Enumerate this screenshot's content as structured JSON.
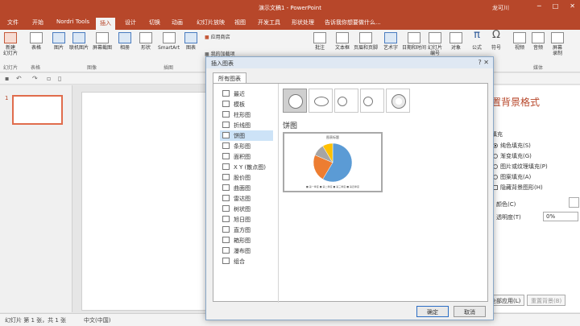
{
  "window": {
    "title": "演示文稿1 - PowerPoint",
    "user": "龙可川",
    "controls": [
      "─",
      "□",
      "✕"
    ]
  },
  "tabs": [
    "文件",
    "开始",
    "Nordri Tools",
    "插入",
    "设计",
    "切换",
    "动画",
    "幻灯片放映",
    "视图",
    "开发工具",
    "形状处理"
  ],
  "active_tab": "插入",
  "tell_me": "告诉我你想要做什么...",
  "ribbon": {
    "new_slide": "新建\n幻灯片",
    "table": "表格",
    "picture": "图片",
    "online_picture": "联机图片",
    "screenshot": "屏幕截图",
    "album": "相册",
    "shapes": "形状",
    "smartart": "SmartArt",
    "chart": "图表",
    "store": "应用商店",
    "my_addins": "我的加载项",
    "comment": "批注",
    "textbox": "文本框",
    "header_footer": "页眉和页脚",
    "wordart": "艺术字",
    "datetime": "日期和时间",
    "slide_number": "幻灯片\n编号",
    "object": "对象",
    "equation": "公式",
    "symbol": "符号",
    "video": "视频",
    "audio": "音频",
    "screen_recording": "屏幕\n录制",
    "groups": {
      "slides": "幻灯片",
      "tables": "表格",
      "images": "图像",
      "illustrations": "插图",
      "media": "媒体"
    }
  },
  "thumbnails": {
    "slide_number": "1"
  },
  "format_pane": {
    "title": "置背景格式",
    "fill_section": "填充",
    "options": [
      "纯色填充(S)",
      "渐变填充(G)",
      "图片或纹理填充(P)",
      "图案填充(A)",
      "隐藏背景图形(H)"
    ],
    "selected_option": "纯色填充(S)",
    "color_label": "颜色(C)",
    "transparency_label": "透明度(T)",
    "transparency_value": "0%",
    "apply_all": "全部应用(L)",
    "reset_background": "重置背景(B)"
  },
  "dialog": {
    "title": "插入图表",
    "close": "?  ✕",
    "tab": "所有图表",
    "categories": [
      "最近",
      "模板",
      "柱形图",
      "折线图",
      "饼图",
      "条形图",
      "面积图",
      "X Y (散点图)",
      "股价图",
      "曲面图",
      "雷达图",
      "树状图",
      "旭日图",
      "直方图",
      "箱形图",
      "瀑布图",
      "组合"
    ],
    "selected_category": "饼图",
    "selected_type": "饼图",
    "preview_title": "图表标题",
    "preview_legend": "■ 第一季度  ■ 第二季度  ■ 第三季度  ■ 第四季度",
    "ok": "确定",
    "cancel": "取消"
  },
  "chart_data": {
    "type": "pie",
    "title": "图表标题",
    "categories": [
      "第一季度",
      "第二季度",
      "第三季度",
      "第四季度"
    ],
    "values": [
      8.2,
      3.2,
      1.4,
      1.2
    ],
    "colors": [
      "#5b9bd5",
      "#ed7d31",
      "#a5a5a5",
      "#ffc000"
    ]
  },
  "status": {
    "slide_info": "幻灯片 第 1 张，共 1 张",
    "language": "中文(中国)"
  },
  "colors": {
    "accent": "#b7472a",
    "selection": "#cde3f7"
  }
}
